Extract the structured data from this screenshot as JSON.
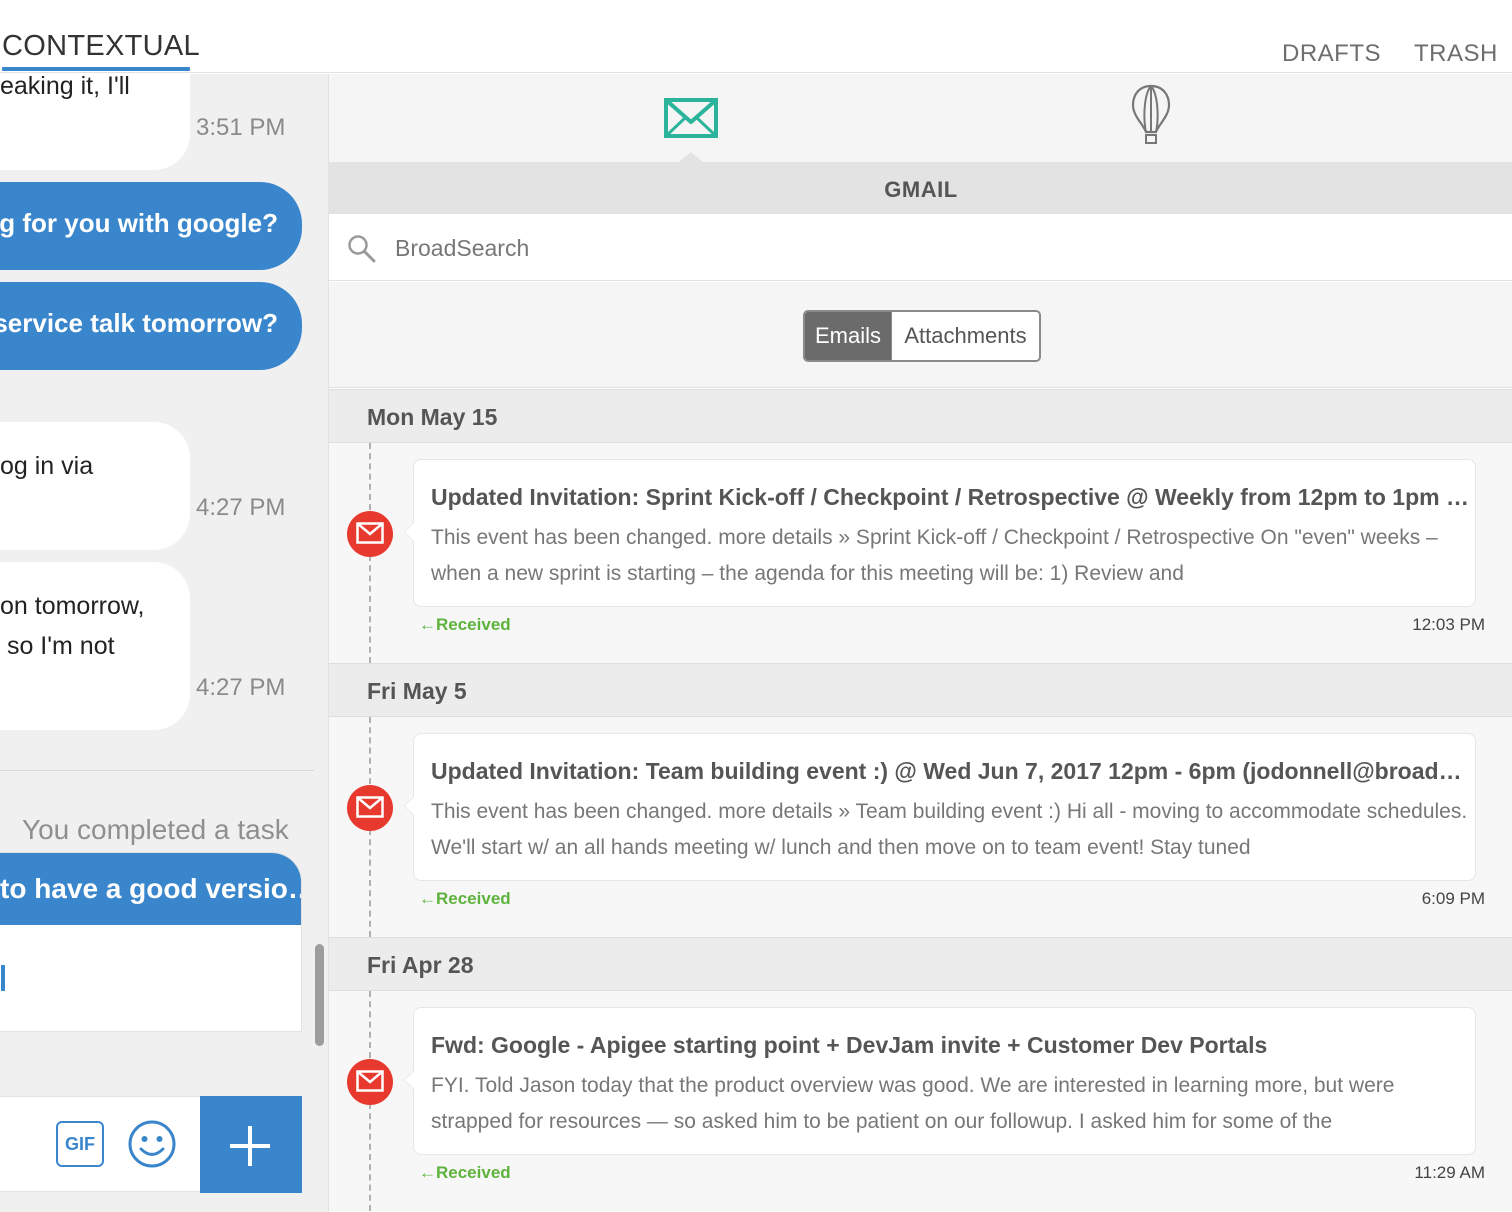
{
  "topbar": {
    "active_tab": "CONTEXTUAL",
    "drafts": "DRAFTS",
    "trash": "TRASH"
  },
  "chat": {
    "messages": [
      {
        "direction": "incoming",
        "text_lines": [
          "eaking it, I'll"
        ],
        "time": "3:51 PM"
      },
      {
        "direction": "outgoing",
        "text": "ing for you with google?"
      },
      {
        "direction": "outgoing",
        "text": "e service talk tomorrow?"
      },
      {
        "direction": "incoming",
        "text_lines": [
          "og in via"
        ],
        "time": "4:27 PM"
      },
      {
        "direction": "incoming",
        "text_lines": [
          "on tomorrow,",
          " so I'm not"
        ],
        "time": "4:27 PM"
      }
    ],
    "task_notice": "You completed a task",
    "task_card_title": "to have a good versio…",
    "composer": {
      "gif_label": "GIF",
      "icons": [
        "emoji-icon",
        "plus-icon"
      ]
    }
  },
  "mail": {
    "source_tabs": [
      {
        "icon": "envelope-icon",
        "active": true
      },
      {
        "icon": "hot-air-balloon-icon",
        "active": false
      }
    ],
    "source_title": "GMAIL",
    "search": {
      "placeholder": "BroadSearch",
      "value": ""
    },
    "segments": {
      "emails": "Emails",
      "attachments": "Attachments",
      "selected": "Emails"
    },
    "groups": [
      {
        "date": "Mon May 15",
        "emails": [
          {
            "subject": "Updated Invitation: Sprint Kick-off / Checkpoint / Retrospective @ Weekly from 12pm to 1pm o...",
            "snippet": "This event has been changed. more details » Sprint Kick-off / Checkpoint / Retrospective On \"even\" weeks – when a new sprint is starting – the agenda for this meeting will be: 1) Review and",
            "status": "←Received",
            "time": "12:03 PM"
          }
        ]
      },
      {
        "date": "Fri May 5",
        "emails": [
          {
            "subject": "Updated Invitation: Team building event :) @ Wed Jun 7, 2017 12pm - 6pm (jodonnell@broadso...",
            "snippet": "This event has been changed. more details » Team building event :) Hi all - moving to accommodate schedules. We'll start w/ an all hands meeting w/ lunch and then move on to team event! Stay tuned",
            "status": "←Received",
            "time": "6:09 PM"
          }
        ]
      },
      {
        "date": "Fri Apr 28",
        "emails": [
          {
            "subject": "Fwd: Google - Apigee starting point + DevJam invite + Customer Dev Portals",
            "snippet": "FYI. Told Jason today that the product overview was good. We are interested in learning more, but were strapped for resources — so asked him to be patient on our followup. I asked him for some of the",
            "status": "←Received",
            "time": "11:29 AM"
          }
        ]
      }
    ]
  },
  "colors": {
    "accent_blue": "#3a86cc",
    "mail_green": "#2bb39b",
    "badge_red": "#e8392f",
    "received_green": "#5db33c"
  }
}
